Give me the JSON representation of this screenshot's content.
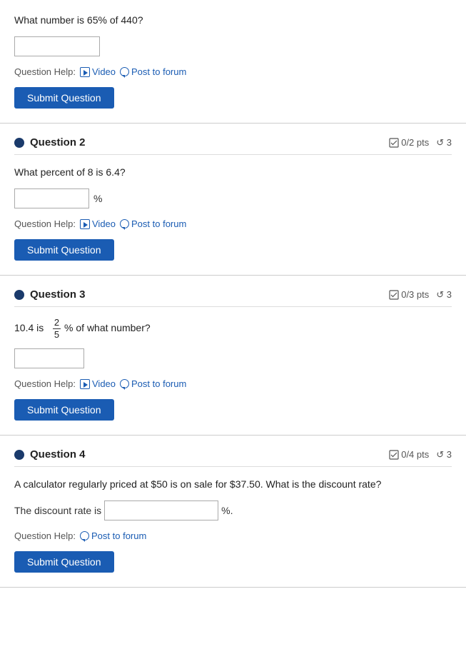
{
  "questions": [
    {
      "id": "q1",
      "number": null,
      "title": null,
      "pts": null,
      "retries": null,
      "body": "What number is 65% of 440?",
      "input_type": "standalone",
      "input_width": "wide",
      "suffix": null,
      "inline_prefix": null,
      "inline_suffix": null,
      "has_fraction": false,
      "help_label": "Question Help:",
      "video_label": "Video",
      "forum_label": "Post to forum",
      "submit_label": "Submit Question",
      "show_header": false
    },
    {
      "id": "q2",
      "number": "Question 2",
      "title": "Question 2",
      "pts": "0/2 pts",
      "retries": "3",
      "body": "What percent of 8 is 6.4?",
      "input_type": "standalone_suffix",
      "input_width": "medium",
      "suffix": "%",
      "inline_prefix": null,
      "inline_suffix": null,
      "has_fraction": false,
      "help_label": "Question Help:",
      "video_label": "Video",
      "forum_label": "Post to forum",
      "submit_label": "Submit Question",
      "show_header": true
    },
    {
      "id": "q3",
      "number": "Question 3",
      "title": "Question 3",
      "pts": "0/3 pts",
      "retries": "3",
      "body_pre": "10.4 is",
      "body_post": "% of what number?",
      "has_fraction": true,
      "fraction_num": "2",
      "fraction_den": "5",
      "input_type": "standalone",
      "input_width": "small",
      "suffix": null,
      "inline_prefix": null,
      "inline_suffix": null,
      "help_label": "Question Help:",
      "video_label": "Video",
      "forum_label": "Post to forum",
      "submit_label": "Submit Question",
      "show_header": true
    },
    {
      "id": "q4",
      "number": "Question 4",
      "title": "Question 4",
      "pts": "0/4 pts",
      "retries": "3",
      "body": "A calculator regularly priced at $50 is on sale for $37.50. What is the discount rate?",
      "input_type": "inline",
      "input_width": "inline",
      "suffix": null,
      "inline_prefix": "The discount rate is",
      "inline_suffix": "%.",
      "has_fraction": false,
      "help_label": "Question Help:",
      "video_label": null,
      "forum_label": "Post to forum",
      "submit_label": "Submit Question",
      "show_header": true
    }
  ]
}
